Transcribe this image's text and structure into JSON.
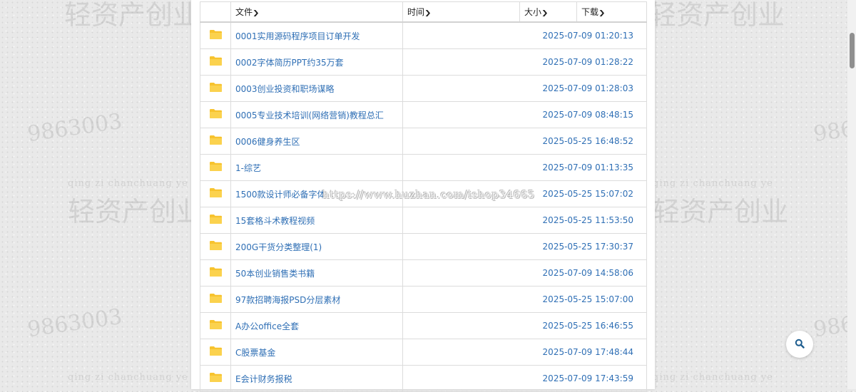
{
  "header": {
    "col_file": "文件",
    "col_time": "时间",
    "col_size": "大小",
    "col_download": "下载"
  },
  "files": [
    {
      "name": "0001实用源码程序项目订单开发",
      "time": "2025-07-09 01:20:13"
    },
    {
      "name": "0002字体简历PPT约35万套",
      "time": "2025-07-09 01:28:22"
    },
    {
      "name": "0003创业投资和职场谋略",
      "time": "2025-07-09 01:28:03"
    },
    {
      "name": "0005专业技术培训(网络营销)教程总汇",
      "time": "2025-07-09 08:48:15"
    },
    {
      "name": "0006健身养生区",
      "time": "2025-05-25 16:48:52"
    },
    {
      "name": "1-综艺",
      "time": "2025-07-09 01:13:35"
    },
    {
      "name": "1500款设计师必备字体",
      "time": "2025-05-25 15:07:02"
    },
    {
      "name": "15套格斗术教程视频",
      "time": "2025-05-25 11:53:50"
    },
    {
      "name": "200G干货分类整理(1)",
      "time": "2025-05-25 17:30:37"
    },
    {
      "name": "50本创业销售类书籍",
      "time": "2025-07-09 14:58:06"
    },
    {
      "name": "97款招聘海报PSD分层素材",
      "time": "2025-05-25 15:07:00"
    },
    {
      "name": "A办公office全套",
      "time": "2025-05-25 16:46:55"
    },
    {
      "name": "C股票基金",
      "time": "2025-07-09 17:48:44"
    },
    {
      "name": "E会计财务报税",
      "time": "2025-07-09 17:43:59"
    }
  ],
  "watermarks": {
    "brand": "轻资产创业",
    "number": "9863003",
    "pinyin": "qing  zi  chanchuang  ye",
    "url": "https://www.huzhan.com/ishop34665"
  },
  "icons": {
    "folder": "folder-icon",
    "sort": "chevron-down-icon",
    "search": "search-icon"
  },
  "colors": {
    "link": "#2f6fb5",
    "folder": "#f7c32e"
  }
}
